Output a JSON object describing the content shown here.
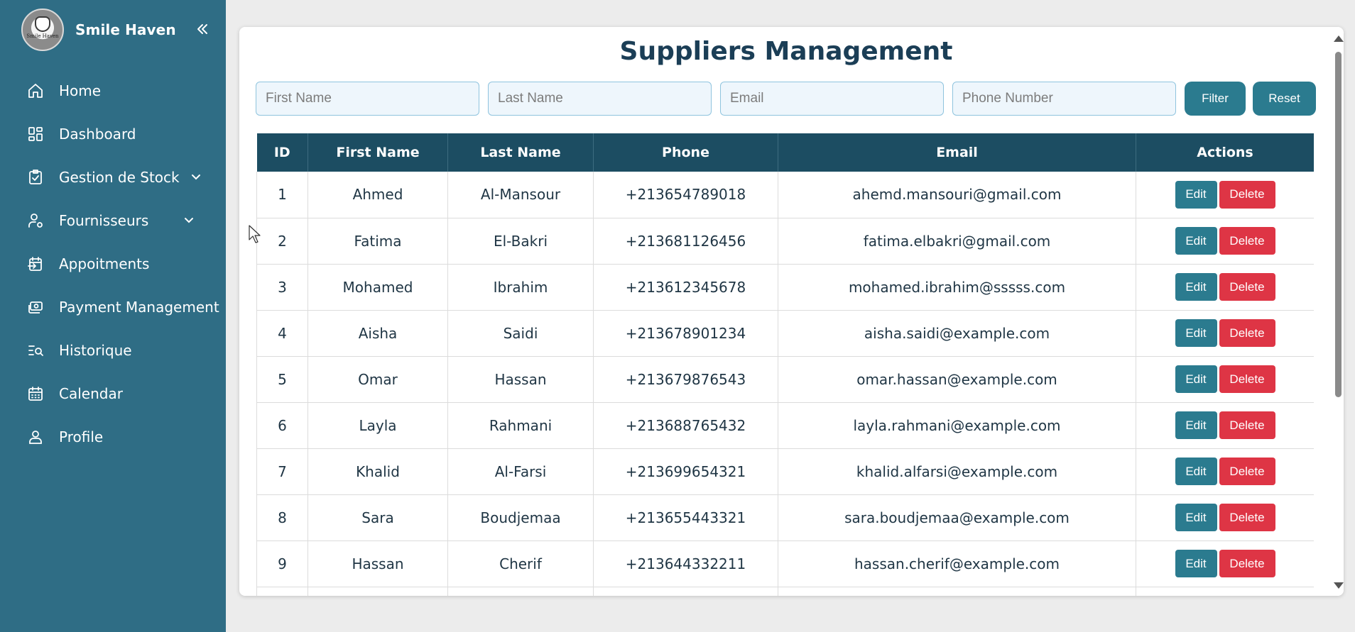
{
  "sidebar": {
    "brand": {
      "name": "Smile Haven",
      "logo_text": "Smile Haven"
    },
    "items": [
      {
        "label": "Home",
        "icon": "home-icon"
      },
      {
        "label": "Dashboard",
        "icon": "dashboard-icon"
      },
      {
        "label": "Gestion de Stock",
        "icon": "clipboard-check-icon",
        "expandable": true
      },
      {
        "label": "Fournisseurs",
        "icon": "user-settings-icon",
        "expandable": true
      },
      {
        "label": "Appoitments",
        "icon": "calendar-arrow-icon"
      },
      {
        "label": "Payment Management",
        "icon": "money-icon"
      },
      {
        "label": "Historique",
        "icon": "list-search-icon"
      },
      {
        "label": "Calendar",
        "icon": "calendar-icon"
      },
      {
        "label": "Profile",
        "icon": "user-icon"
      }
    ]
  },
  "main": {
    "title": "Suppliers Management",
    "filters": {
      "first_name": {
        "placeholder": "First Name",
        "value": ""
      },
      "last_name": {
        "placeholder": "Last Name",
        "value": ""
      },
      "email": {
        "placeholder": "Email",
        "value": ""
      },
      "phone": {
        "placeholder": "Phone Number",
        "value": ""
      },
      "filter_label": "Filter",
      "reset_label": "Reset"
    },
    "table": {
      "headers": [
        "ID",
        "First Name",
        "Last Name",
        "Phone",
        "Email",
        "Actions"
      ],
      "edit_label": "Edit",
      "delete_label": "Delete",
      "rows": [
        {
          "id": "1",
          "first": "Ahmed",
          "last": "Al-Mansour",
          "phone": "+213654789018",
          "email": "ahemd.mansouri@gmail.com"
        },
        {
          "id": "2",
          "first": "Fatima",
          "last": "El-Bakri",
          "phone": "+213681126456",
          "email": "fatima.elbakri@gmail.com"
        },
        {
          "id": "3",
          "first": "Mohamed",
          "last": "Ibrahim",
          "phone": "+213612345678",
          "email": "mohamed.ibrahim@sssss.com"
        },
        {
          "id": "4",
          "first": "Aisha",
          "last": "Saidi",
          "phone": "+213678901234",
          "email": "aisha.saidi@example.com"
        },
        {
          "id": "5",
          "first": "Omar",
          "last": "Hassan",
          "phone": "+213679876543",
          "email": "omar.hassan@example.com"
        },
        {
          "id": "6",
          "first": "Layla",
          "last": "Rahmani",
          "phone": "+213688765432",
          "email": "layla.rahmani@example.com"
        },
        {
          "id": "7",
          "first": "Khalid",
          "last": "Al-Farsi",
          "phone": "+213699654321",
          "email": "khalid.alfarsi@example.com"
        },
        {
          "id": "8",
          "first": "Sara",
          "last": "Boudjemaa",
          "phone": "+213655443321",
          "email": "sara.boudjemaa@example.com"
        },
        {
          "id": "9",
          "first": "Hassan",
          "last": "Cherif",
          "phone": "+213644332211",
          "email": "hassan.cherif@example.com"
        }
      ]
    }
  },
  "colors": {
    "sidebar_bg": "#2f6d85",
    "header_bg": "#1c4d62",
    "title_color": "#1b3e56",
    "primary_button": "#2b7b8f",
    "danger_button": "#de3545"
  }
}
